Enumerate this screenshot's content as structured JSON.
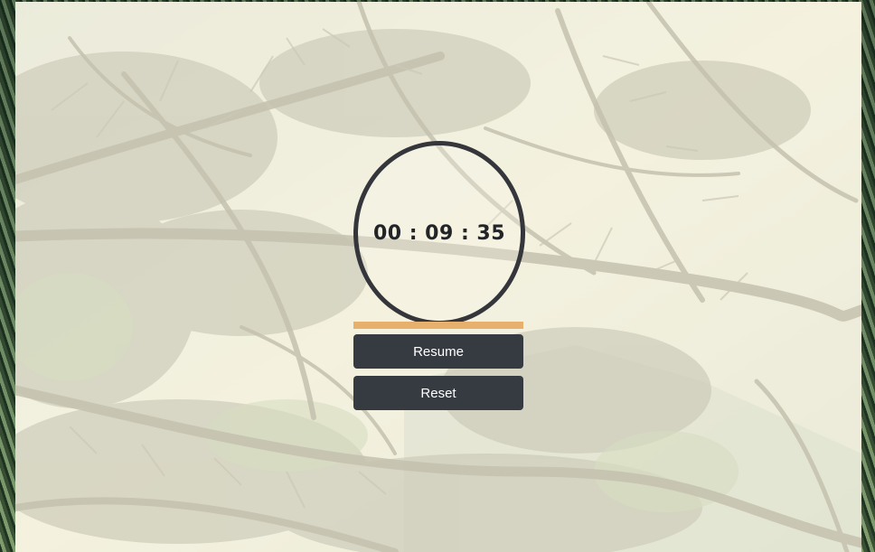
{
  "timer": {
    "hours": "00",
    "minutes": "09",
    "seconds": "35",
    "display": "00 : 09 : 35",
    "progress": 1.0
  },
  "controls": {
    "resume_label": "Resume",
    "reset_label": "Reset"
  },
  "colors": {
    "ring": "#34363b",
    "button_bg": "#363a41",
    "button_text": "#ffffff",
    "progress_fill": "#e7b06d",
    "panel_tint": "#f6f4e2"
  }
}
